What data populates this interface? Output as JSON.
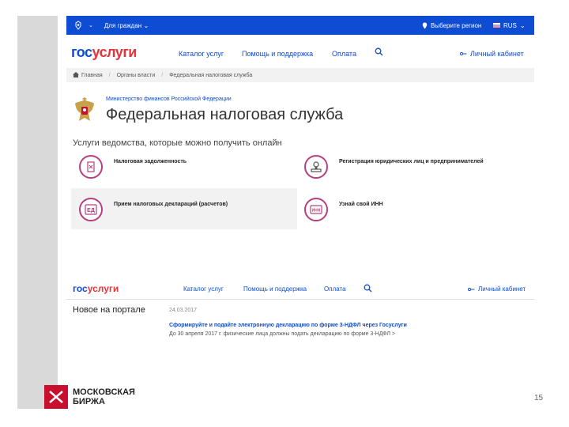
{
  "topbar": {
    "dept_selector": "Для граждан",
    "region": "Выберите регион",
    "lang": "RUS"
  },
  "header": {
    "logo_gos": "гос",
    "logo_uslugi": "услуги",
    "nav": [
      "Каталог услуг",
      "Помощь и поддержка",
      "Оплата"
    ],
    "cabinet": "Личный кабинет"
  },
  "breadcrumb": [
    "Главная",
    "Органы власти",
    "Федеральная налоговая служба"
  ],
  "department": {
    "ministry": "Министерство финансов Российской Федерации",
    "title": "Федеральная налоговая служба"
  },
  "services_caption": "Услуги ведомства, которые можно получить онлайн",
  "services": [
    {
      "label": "Налоговая задолженность",
      "icon": "tax-debt-icon"
    },
    {
      "label": "Регистрация юридических лиц и предпринимателей",
      "icon": "registration-stamp-icon"
    },
    {
      "label": "Прием налоговых деклараций (расчетов)",
      "icon": "declaration-icon"
    },
    {
      "label": "Узнай свой ИНН",
      "icon": "inn-card-icon"
    }
  ],
  "header2": {
    "logo_gos": "гос",
    "logo_uslugi": "услуги",
    "nav": [
      "Каталог услуг",
      "Помощь и поддержка",
      "Оплата"
    ],
    "cabinet": "Личный кабинет"
  },
  "news": {
    "section_title": "Новое на портале",
    "date": "24.03.2017",
    "headline": "Сформируйте и подайте электронную декларацию по форме 3-НДФЛ через Госуслуги",
    "text": "До 30 апреля 2017 г. физические лица должны подать декларацию по форме 3-НДФЛ  >"
  },
  "footer": {
    "brand_line1": "МОСКОВСКАЯ",
    "brand_line2": "БИРЖА",
    "page_number": "15"
  },
  "colors": {
    "gos_blue": "#0d4cd3",
    "gos_red": "#e4343a",
    "service_purple": "#b6407f",
    "moex_red": "#c8102e"
  }
}
